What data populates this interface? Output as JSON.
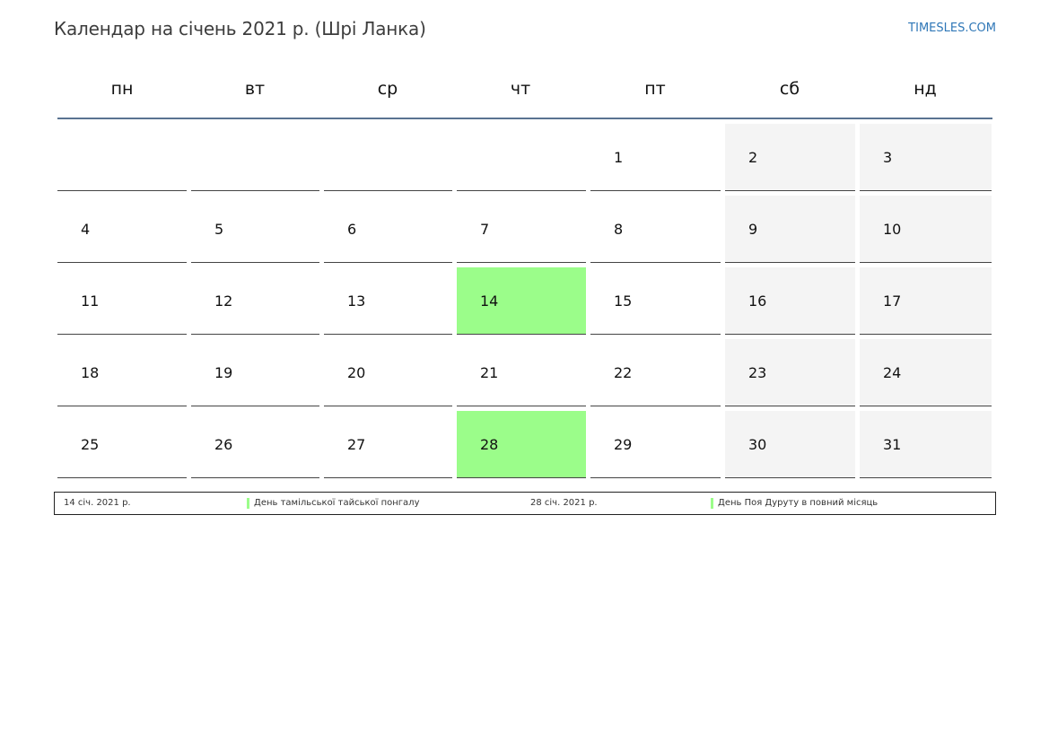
{
  "header": {
    "title": "Календар на січень 2021 р. (Шрі Ланка)",
    "brand": "TIMESLES.COM"
  },
  "calendar": {
    "weekdays": [
      "пн",
      "вт",
      "ср",
      "чт",
      "пт",
      "сб",
      "нд"
    ],
    "weeks": [
      [
        "",
        "",
        "",
        "",
        "1",
        "2",
        "3"
      ],
      [
        "4",
        "5",
        "6",
        "7",
        "8",
        "9",
        "10"
      ],
      [
        "11",
        "12",
        "13",
        "14",
        "15",
        "16",
        "17"
      ],
      [
        "18",
        "19",
        "20",
        "21",
        "22",
        "23",
        "24"
      ],
      [
        "25",
        "26",
        "27",
        "28",
        "29",
        "30",
        "31"
      ]
    ],
    "holidays": [
      "14",
      "28"
    ]
  },
  "legend": [
    {
      "date": "14 січ. 2021 р.",
      "name": "День тамільської тайської понгалу"
    },
    {
      "date": "28 січ. 2021 р.",
      "name": "День Поя Дуруту в повний місяць"
    }
  ],
  "colors": {
    "holiday": "#9bfd8a",
    "weekend": "#f4f4f4",
    "header_rule": "#5a7391",
    "brand": "#2f77b7"
  }
}
